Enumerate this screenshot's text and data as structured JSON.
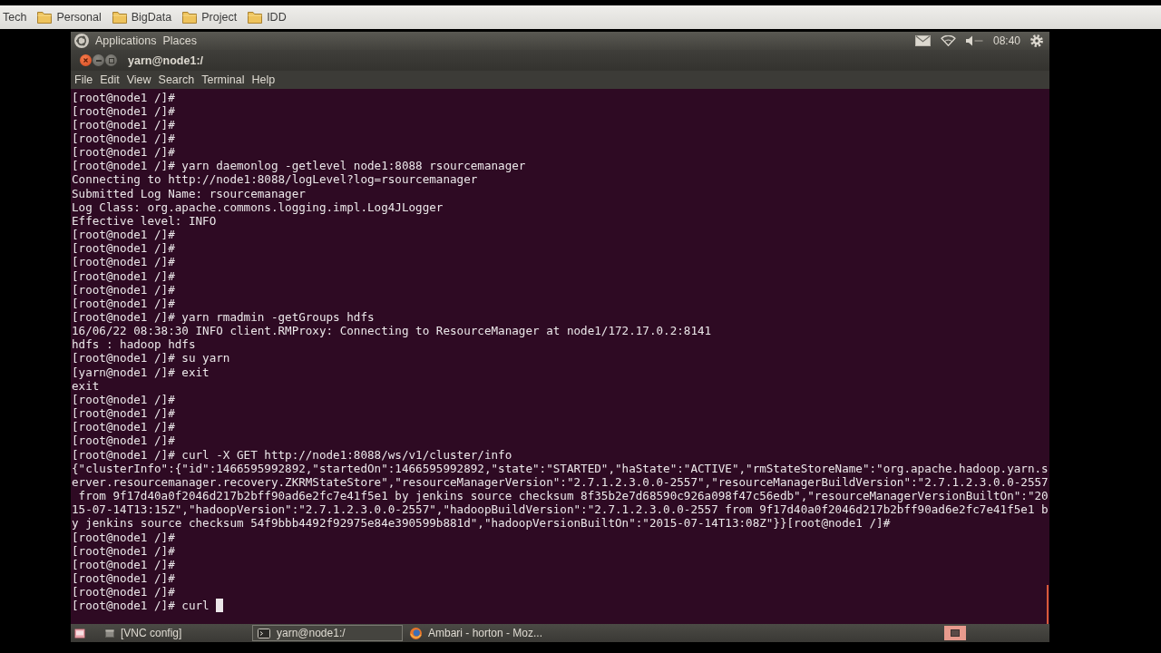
{
  "bookmarks_bar": {
    "items": [
      {
        "label": "Tech",
        "kind": "plain"
      },
      {
        "label": "Personal",
        "kind": "folder"
      },
      {
        "label": "BigData",
        "kind": "folder"
      },
      {
        "label": "Project",
        "kind": "folder"
      },
      {
        "label": "IDD",
        "kind": "folder"
      }
    ]
  },
  "top_panel": {
    "menus": [
      "Applications",
      "Places"
    ],
    "clock": "08:40"
  },
  "window": {
    "title": "yarn@node1:/",
    "menu": [
      "File",
      "Edit",
      "View",
      "Search",
      "Terminal",
      "Help"
    ]
  },
  "terminal": {
    "lines": [
      "[root@node1 /]#",
      "[root@node1 /]#",
      "[root@node1 /]#",
      "[root@node1 /]#",
      "[root@node1 /]#",
      "[root@node1 /]# yarn daemonlog -getlevel node1:8088 rsourcemanager",
      "Connecting to http://node1:8088/logLevel?log=rsourcemanager",
      "Submitted Log Name: rsourcemanager",
      "Log Class: org.apache.commons.logging.impl.Log4JLogger",
      "Effective level: INFO",
      "[root@node1 /]#",
      "[root@node1 /]#",
      "[root@node1 /]#",
      "[root@node1 /]#",
      "[root@node1 /]#",
      "[root@node1 /]#",
      "[root@node1 /]# yarn rmadmin -getGroups hdfs",
      "16/06/22 08:38:30 INFO client.RMProxy: Connecting to ResourceManager at node1/172.17.0.2:8141",
      "hdfs : hadoop hdfs",
      "[root@node1 /]# su yarn",
      "[yarn@node1 /]# exit",
      "exit",
      "[root@node1 /]#",
      "[root@node1 /]#",
      "[root@node1 /]#",
      "[root@node1 /]#",
      "[root@node1 /]# curl -X GET http://node1:8088/ws/v1/cluster/info",
      "{\"clusterInfo\":{\"id\":1466595992892,\"startedOn\":1466595992892,\"state\":\"STARTED\",\"haState\":\"ACTIVE\",\"rmStateStoreName\":\"org.apache.hadoop.yarn.s",
      "erver.resourcemanager.recovery.ZKRMStateStore\",\"resourceManagerVersion\":\"2.7.1.2.3.0.0-2557\",\"resourceManagerBuildVersion\":\"2.7.1.2.3.0.0-2557",
      " from 9f17d40a0f2046d217b2bff90ad6e2fc7e41f5e1 by jenkins source checksum 8f35b2e7d68590c926a098f47c56edb\",\"resourceManagerVersionBuiltOn\":\"20",
      "15-07-14T13:15Z\",\"hadoopVersion\":\"2.7.1.2.3.0.0-2557\",\"hadoopBuildVersion\":\"2.7.1.2.3.0.0-2557 from 9f17d40a0f2046d217b2bff90ad6e2fc7e41f5e1 b",
      "y jenkins source checksum 54f9bbb4492f92975e84e390599b881d\",\"hadoopVersionBuiltOn\":\"2015-07-14T13:08Z\"}}[root@node1 /]#",
      "[root@node1 /]#",
      "[root@node1 /]#",
      "[root@node1 /]#",
      "[root@node1 /]#",
      "[root@node1 /]#",
      "[root@node1 /]# curl"
    ],
    "cursor": true
  },
  "taskbar": {
    "items": [
      {
        "label": "[VNC config]",
        "selected": false
      },
      {
        "label": "yarn@node1:/",
        "selected": true
      },
      {
        "label": "Ambari - horton - Moz...",
        "selected": false
      }
    ]
  }
}
